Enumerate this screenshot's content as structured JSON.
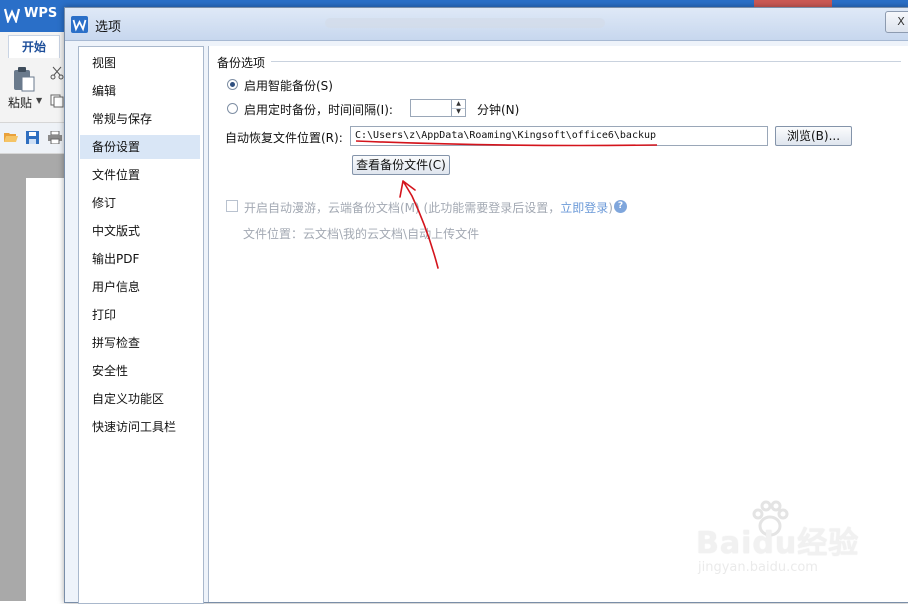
{
  "app": {
    "name": "WPS",
    "tab_start": "开始",
    "paste_label": "粘贴"
  },
  "dialog": {
    "title": "选项",
    "close_label": "X",
    "nav": [
      {
        "label": "视图"
      },
      {
        "label": "编辑"
      },
      {
        "label": "常规与保存"
      },
      {
        "label": "备份设置",
        "selected": true
      },
      {
        "label": "文件位置"
      },
      {
        "label": "修订"
      },
      {
        "label": "中文版式"
      },
      {
        "label": "输出PDF"
      },
      {
        "label": "用户信息"
      },
      {
        "label": "打印"
      },
      {
        "label": "拼写检查"
      },
      {
        "label": "安全性"
      },
      {
        "label": "自定义功能区"
      },
      {
        "label": "快速访问工具栏"
      }
    ],
    "backup": {
      "group_title": "备份选项",
      "smart_backup_label": "启用智能备份(S)",
      "smart_backup_checked": true,
      "timed_backup_label": "启用定时备份，时间间隔(I):",
      "timed_backup_checked": false,
      "interval_value": "",
      "interval_unit": "分钟(N)",
      "recover_location_label": "自动恢复文件位置(R):",
      "recover_location_value": "C:\\Users\\z\\AppData\\Roaming\\Kingsoft\\office6\\backup",
      "browse_button": "浏览(B)...",
      "view_backup_button": "查看备份文件(C)",
      "roaming_label": "开启自动漫游，云端备份文档(M) (此功能需要登录后设置，",
      "roaming_link": "立即登录",
      "roaming_link_suffix": ")",
      "roaming_checked": false,
      "file_location_note": "文件位置：云文档\\我的云文档\\自动上传文件"
    }
  },
  "watermark": {
    "brand": "Baidu经验",
    "url": "jingyan.baidu.com"
  },
  "colors": {
    "accent_blue": "#2a6fc8",
    "selected_nav": "#d9e6f6",
    "annotation_red": "#d4141c",
    "link": "#6c9ad8"
  }
}
